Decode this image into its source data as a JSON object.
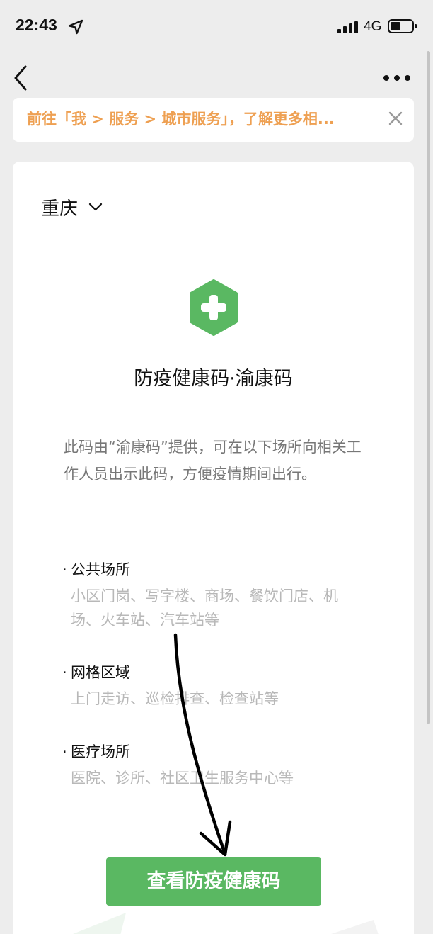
{
  "status_bar": {
    "time": "22:43",
    "network": "4G",
    "icons": [
      "location-arrow-icon",
      "signal-bars-icon",
      "battery-icon"
    ]
  },
  "nav": {
    "icons": [
      "back-chevron-icon",
      "more-dots-icon"
    ]
  },
  "banner": {
    "text": "前往「我 > 服务 > 城市服务」，了解更多相...",
    "close_icon": "close-icon",
    "text_color": "#eea052"
  },
  "card": {
    "city": "重庆",
    "city_icon": "chevron-down-icon",
    "logo_icon": "green-hexagon-plus-icon",
    "title": "防疫健康码·渝康码",
    "description": "此码由“渝康码”提供，可在以下场所向相关工作人员出示此码，方便疫情期间出行。",
    "places": [
      {
        "title": "公共场所",
        "examples": "小区门岗、写字楼、商场、餐饮门店、机场、火车站、汽车站等"
      },
      {
        "title": "网格区域",
        "examples": "上门走访、巡检排查、检查站等"
      },
      {
        "title": "医疗场所",
        "examples": "医院、诊所、社区卫生服务中心等"
      }
    ],
    "button_label": "查看防疫健康码",
    "accent_color": "#5ab862"
  },
  "annotation": {
    "icon": "hand-drawn-arrow-icon"
  }
}
